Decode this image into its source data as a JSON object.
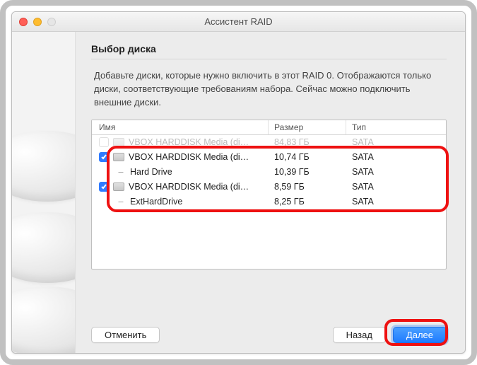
{
  "window": {
    "title": "Ассистент RAID"
  },
  "heading": "Выбор диска",
  "description": "Добавьте диски, которые нужно включить в этот RAID 0. Отображаются только диски, соответствующие требованиям набора. Сейчас можно подключить внешние диски.",
  "table": {
    "headers": {
      "name": "Имя",
      "size": "Размер",
      "type": "Тип"
    },
    "rows": [
      {
        "checked": false,
        "dim": true,
        "indent": 0,
        "icon": "disk",
        "name": "VBOX HARDDISK Media (di…",
        "size": "84,83 ГБ",
        "type": "SATA"
      },
      {
        "checked": true,
        "dim": false,
        "indent": 0,
        "icon": "disk",
        "name": "VBOX HARDDISK Media (di…",
        "size": "10,74 ГБ",
        "type": "SATA"
      },
      {
        "checked": null,
        "dim": false,
        "indent": 1,
        "icon": "dash",
        "name": "Hard Drive",
        "size": "10,39 ГБ",
        "type": "SATA"
      },
      {
        "checked": true,
        "dim": false,
        "indent": 0,
        "icon": "disk",
        "name": "VBOX HARDDISK Media (di…",
        "size": "8,59 ГБ",
        "type": "SATA"
      },
      {
        "checked": null,
        "dim": false,
        "indent": 1,
        "icon": "dash",
        "name": "ExtHardDrive",
        "size": "8,25 ГБ",
        "type": "SATA"
      }
    ]
  },
  "buttons": {
    "cancel": "Отменить",
    "back": "Назад",
    "next": "Далее"
  }
}
